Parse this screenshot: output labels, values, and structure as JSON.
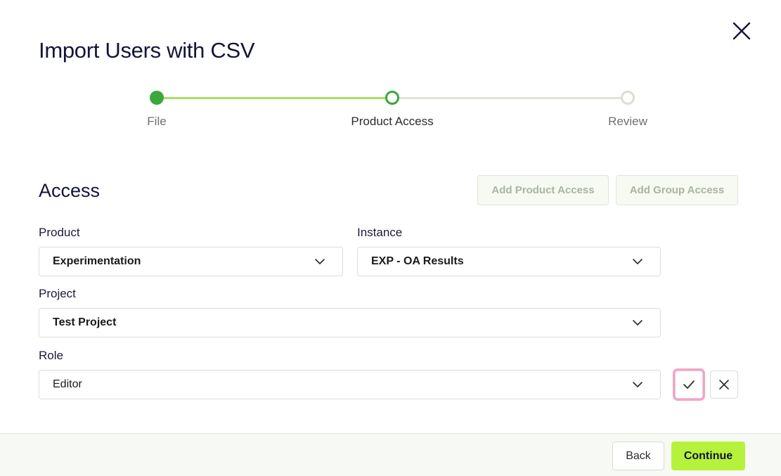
{
  "dialog": {
    "title": "Import Users with CSV",
    "close_icon": "close-icon"
  },
  "stepper": {
    "steps": [
      {
        "label": "File",
        "state": "complete"
      },
      {
        "label": "Product Access",
        "state": "current"
      },
      {
        "label": "Review",
        "state": "pending"
      }
    ],
    "colors": {
      "complete": "#3aa83a",
      "progress": "#a3e35c",
      "pending": "#e2e2d9"
    }
  },
  "access": {
    "title": "Access",
    "add_product_label": "Add Product Access",
    "add_group_label": "Add Group Access",
    "fields": {
      "product": {
        "label": "Product",
        "value": "Experimentation"
      },
      "instance": {
        "label": "Instance",
        "value": "EXP - OA Results"
      },
      "project": {
        "label": "Project",
        "value": "Test Project"
      },
      "role": {
        "label": "Role",
        "value": "Editor"
      }
    },
    "row_actions": {
      "confirm_icon": "check-icon",
      "remove_icon": "close-icon"
    }
  },
  "footer": {
    "back_label": "Back",
    "continue_label": "Continue"
  },
  "colors": {
    "accent": "#b6f23c",
    "title_text": "#14143a",
    "focus_ring": "#f2a5c8"
  }
}
